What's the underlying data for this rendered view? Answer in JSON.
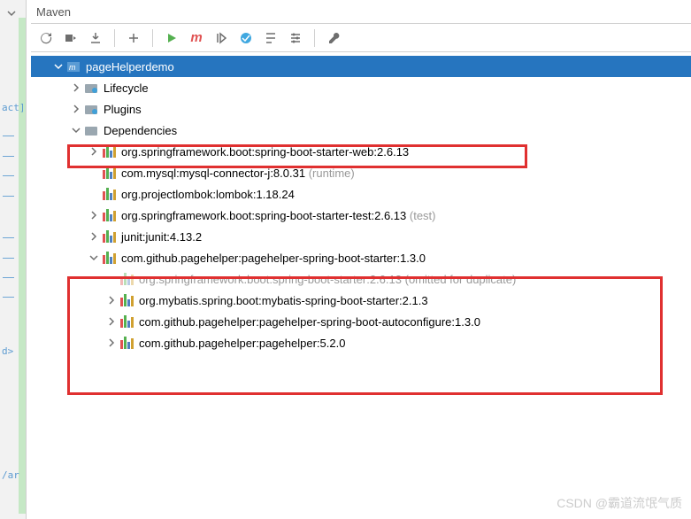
{
  "title": "Maven",
  "gutter": {
    "label_act": "act]",
    "label_d": "d>",
    "label_ar": "/ar"
  },
  "toolbar": {
    "refresh": "refresh",
    "generate": "generate",
    "download": "download",
    "add": "add",
    "run": "run",
    "m": "m",
    "skip": "skip",
    "offline": "offline",
    "collapse": "collapse",
    "settings": "settings",
    "wrench": "wrench"
  },
  "tree": {
    "root": "pageHelperdemo",
    "lifecycle": "Lifecycle",
    "plugins": "Plugins",
    "dependencies": "Dependencies",
    "deps": [
      {
        "label": "org.springframework.boot:spring-boot-starter-web:2.6.13",
        "scope": ""
      },
      {
        "label": "com.mysql:mysql-connector-j:8.0.31",
        "scope": "(runtime)"
      },
      {
        "label": "org.projectlombok:lombok:1.18.24",
        "scope": ""
      },
      {
        "label": "org.springframework.boot:spring-boot-starter-test:2.6.13",
        "scope": "(test)"
      },
      {
        "label": "junit:junit:4.13.2",
        "scope": ""
      },
      {
        "label": "com.github.pagehelper:pagehelper-spring-boot-starter:1.3.0",
        "scope": ""
      }
    ],
    "sub": [
      {
        "label": "org.springframework.boot:spring-boot-starter:2.6.13",
        "scope": "(omitted for duplicate)",
        "dim": true
      },
      {
        "label": "org.mybatis.spring.boot:mybatis-spring-boot-starter:2.1.3",
        "scope": ""
      },
      {
        "label": "com.github.pagehelper:pagehelper-spring-boot-autoconfigure:1.3.0",
        "scope": ""
      },
      {
        "label": "com.github.pagehelper:pagehelper:5.2.0",
        "scope": ""
      }
    ]
  },
  "watermark": "CSDN @霸道流氓气质",
  "colors": {
    "selection": "#2675bf",
    "highlight": "#e03030"
  }
}
